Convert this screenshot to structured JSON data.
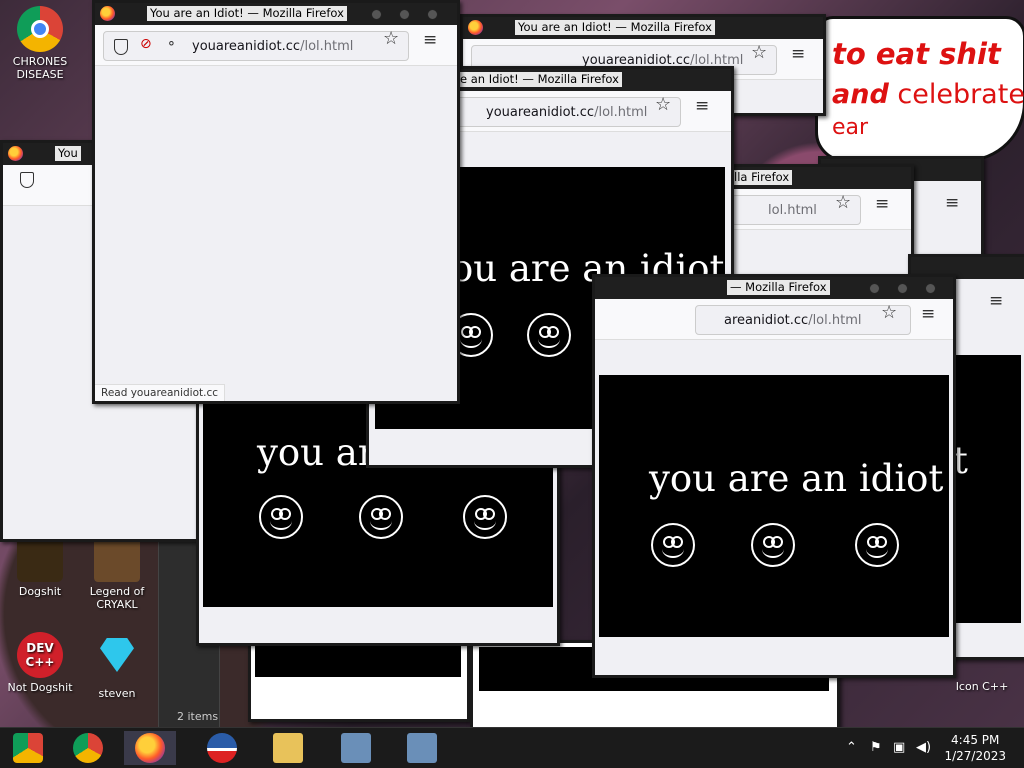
{
  "desktop": {
    "icons": [
      {
        "label": "CHRONES DISEASE",
        "name": "chrome-icon"
      },
      {
        "label": "Dogshit",
        "name": "dogshit-icon"
      },
      {
        "label": "Legend of CRYAKL",
        "name": "legend-of-cryakl-icon"
      },
      {
        "label": "Not Dogshit",
        "name": "dev-cpp-icon"
      },
      {
        "label": "steven",
        "name": "diamond-icon"
      },
      {
        "label": "Icon C++",
        "name": "icon-cpp-icon"
      }
    ],
    "dev_logo_text": "DEV C++",
    "explorer_status": "2 items"
  },
  "banner": {
    "line1": "to eat shit",
    "line2_bold": "and",
    "line2_rest": "celebrate",
    "line3": "ear"
  },
  "windows": {
    "title_full": "You are an Idiot! — Mozilla Firefox",
    "title_partial_1": "e an Idiot! — Mozilla Firefox",
    "title_partial_2": "lla Firefox",
    "title_partial_3": "— Mozilla Firefox",
    "title_partial_4": "You",
    "url_domain": "youareanidiot.cc",
    "url_path": "/lol.html",
    "url_partial_domain": "areanidiot.cc",
    "url_partial_only_path": "lol.html",
    "status_text": "Read youareanidiot.cc",
    "page_text": "you are an idiot",
    "page_text_partial_1": "ou are an idiot",
    "page_text_partial_2": "you are",
    "page_text_partial_3": "ou",
    "page_text_partial_4": "t"
  },
  "taskbar": {
    "time": "4:45 PM",
    "date": "1/27/2023"
  }
}
